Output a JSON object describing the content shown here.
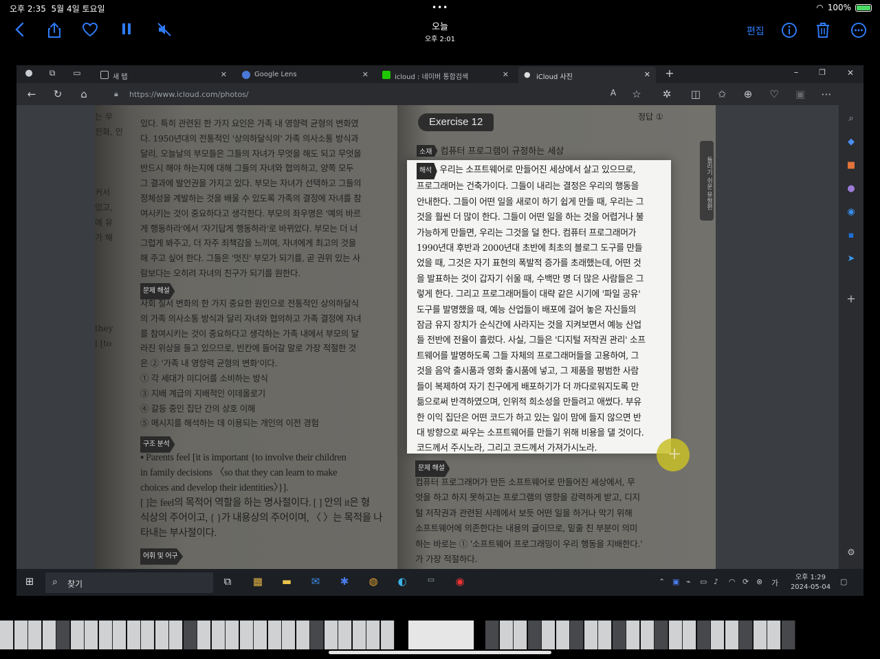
{
  "status": {
    "time": "오후 2:35",
    "date": "5월 4일 토요일",
    "battery": "100%"
  },
  "photo_toolbar": {
    "title": "오늘",
    "subtitle": "오후 2:01",
    "edit_label": "편집"
  },
  "browser": {
    "tabs": [
      {
        "label": "새 탭"
      },
      {
        "label": "Google Lens"
      },
      {
        "label": "icloud : 네이버 통합검색"
      },
      {
        "label": "iCloud 사진"
      }
    ],
    "url": "https://www.icloud.com/photos/"
  },
  "book": {
    "left_paragraph": [
      "있다. 특히 관련된 한 가지 요인은 가족 내 영향력 균형의 변화였",
      "다. 1950년대의 전통적인 '상의하달식의' 가족 의사소통 방식과",
      "달리, 오늘날의 부모들은 그들의 자녀가 무엇을 해도 되고 무엇을",
      "반드시 해야 하는지에 대해 그들의 자녀와 협의하고, 양쪽 모두",
      "그 결과에 발언권을 가지고 있다. 부모는 자녀가 선택하고 그들의",
      "정체성을 계발하는 것을 배울 수 있도록 가족의 결정에 자녀를 참",
      "여시키는 것이 중요하다고 생각한다. 부모의 좌우명은 '예의 바르",
      "게 행동하라'에서 '자기답게 행동하라'로 바뀌었다. 부모는 더 너",
      "그럽게 봐주고, 더 자주 죄책감을 느끼며, 자녀에게 최고의 것을",
      "해 주고 싶어 한다. 그들은 '멋진' 부모가 되기를, 곧 권위 있는 사",
      "람보다는 오히려 자녀의 친구가 되기를 원한다."
    ],
    "problem_label_left": "문제 해설",
    "problem_lines_left": [
      "사회 질서 변화의 한 가지 중요한 원인으로 전통적인 상의하달식",
      "의 가족 의사소통 방식과 달리 자녀와 협의하고 가족 결정에 자녀",
      "를 참여시키는 것이 중요하다고 생각하는 가족 내에서 부모의 달",
      "라진 위상을 들고 있으므로, 빈칸에 들어갈 말로 가장 적절한 것",
      "은 ② '가족 내 영향력 균형의 변화'이다.",
      "① 각 세대가 미디어를 소비하는 방식",
      "③ 지배 계급의 지배적인 이데올로기",
      "④ 갈등 중인 집단 간의 상호 이해",
      "⑤ 메시지를 해석하는 데 이용되는 개인의 이전 경험"
    ],
    "structure_label": "구조 분석",
    "structure_lines": [
      "▪ Parents feel [it is important {to involve their children",
      "  in family decisions 〈so that they can learn to make",
      "  choices and develop their identities〉}].",
      "  [ ]는 feel의 목적어 역할을 하는 명사절이다. [ ] 안의 it은 형",
      "  식상의 주어이고, { }가 내용상의 주어이며, 〈 〉는 목적을 나",
      "  타내는 부사절이다."
    ],
    "vocab_label": "어휘 및 어구",
    "edge_lines": [
      "는 우",
      "진화, 인",
      "",
      "",
      "",
      "커서",
      "있고,",
      "에 유",
      "가 해",
      "",
      "",
      "",
      "",
      "",
      "they",
      "l [to"
    ],
    "exercise_label": "Exercise 12",
    "answer": "정답 ①",
    "topic_tag": "소재",
    "topic": "컴퓨터 프로그램이 규정하는 세상",
    "side_tab": "틀리기 쉬운 유형편",
    "translation_tag": "해석",
    "translation_lines": [
      "우리는 소프트웨어로 만들어진 세상에서 살고 있으므로,",
      "프로그래머는 건축가이다. 그들이 내리는 결정은 우리의 행동을",
      "안내한다. 그들이 어떤 일을 새로이 하기 쉽게 만들 때, 우리는 그",
      "것을 훨씬 더 많이 한다. 그들이 어떤 일을 하는 것을 어렵거나 불",
      "가능하게 만들면, 우리는 그것을 덜 한다. 컴퓨터 프로그래머가",
      "1990년대 후반과 2000년대 초반에 최초의 블로그 도구를 만들",
      "었을 때, 그것은 자기 표현의 폭발적 증가를 초래했는데, 어떤 것",
      "을 발표하는 것이 갑자기 쉬울 때, 수백만 명 더 많은 사람들은 그",
      "렇게 한다. 그리고 프로그래머들이 대략 같은 시기에 '파일 공유'",
      "도구를 발명했을 때, 예능 산업들이 배포에 걸어 놓은 자신들의",
      "잠금 유지 장치가 순식간에 사라지는 것을 지켜보면서 예능 산업",
      "들 전반에 전율이 흘렀다. 사실, 그들은 '디지털 저작권 관리' 소프",
      "트웨어를 발명하도록 그들 자체의 프로그래머들을 고용하여, 그",
      "것을 음악 출시품과 영화 출시품에 넣고, 그 제품을 평범한 사람",
      "들이 복제하여 자기 친구에게 배포하기가 더 까다로워지도록 만",
      "듦으로써 반격하였으며, 인위적 희소성을 만들려고 애썼다. 부유",
      "한 이익 집단은 어떤 코드가 하고 있는 일이 맘에 들지 않으면 반",
      "대 방향으로 싸우는 소프트웨어를 만들기 위해 비용을 댈 것이다.",
      "코드께서 주시노라, 그리고 코드께서 가져가시노라."
    ],
    "problem_label_right": "문제 해설",
    "problem_lines_right": [
      "컴퓨터 프로그래머가 만든 소프트웨어로 만들어진 세상에서, 무",
      "엇을 하고 하지 못하고는 프로그램의 영향을 강력하게 받고, 디지",
      "털 저작권과 관련된 사례에서 보듯 어떤 일을 하거나 막기 위해",
      "소프트웨어에 의존한다는 내용의 글이므로, 밑줄 친 부분이 의미",
      "하는 바로는 ① '소프트웨어 프로그래밍이 우리 행동을 지배한다.'",
      "가 가장 적절하다."
    ]
  },
  "taskbar": {
    "search_label": "찾기",
    "clock_time": "오후 1:29",
    "clock_date": "2024-05-04"
  }
}
